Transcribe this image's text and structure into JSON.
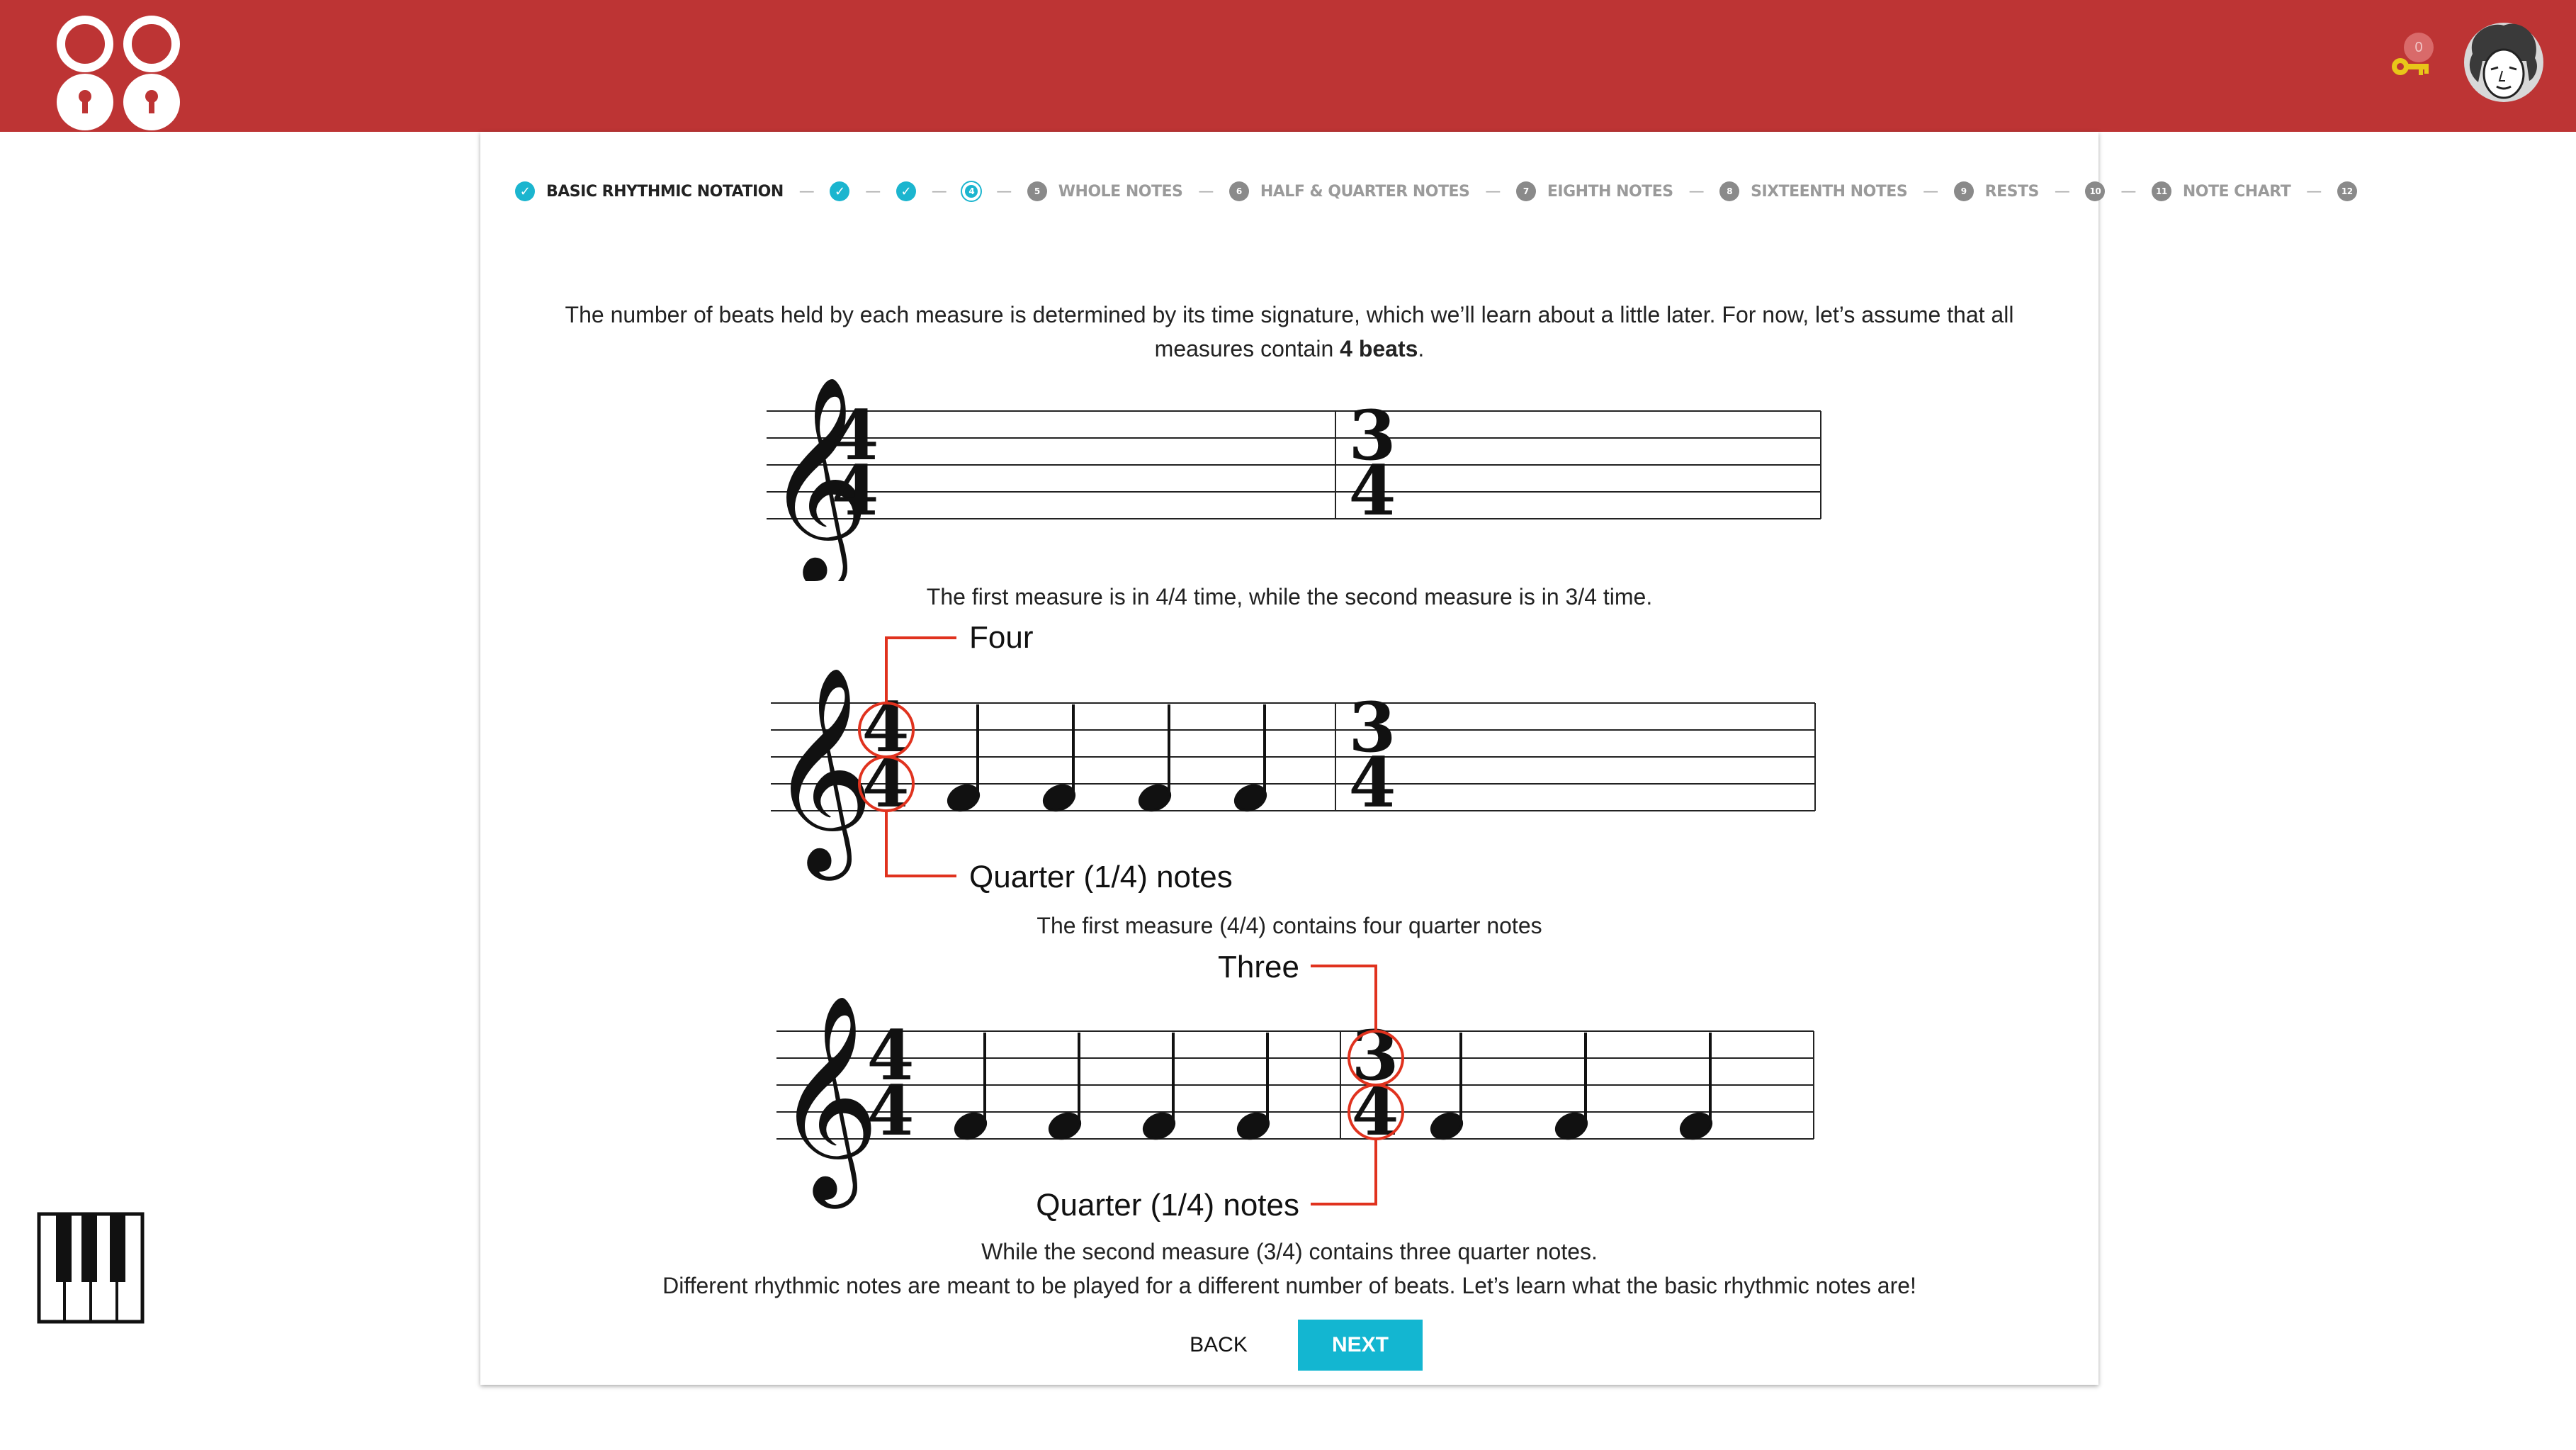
{
  "header": {
    "logo_icon": "eighty-eight-keys-logo-icon",
    "key_icon": "key-icon",
    "key_count": "0",
    "avatar_icon": "beethoven-avatar-icon",
    "bar_color": "#bd3434",
    "key_color": "#e8c619"
  },
  "sidebar": {
    "piano_icon": "piano-keys-icon"
  },
  "stepper": {
    "accent_color": "#1bb5cf",
    "steps": [
      {
        "number": "1",
        "label": "BASIC RHYTHMIC NOTATION",
        "status": "done"
      },
      {
        "number": "2",
        "label": "",
        "status": "done"
      },
      {
        "number": "3",
        "label": "",
        "status": "done"
      },
      {
        "number": "4",
        "label": "",
        "status": "current"
      },
      {
        "number": "5",
        "label": "WHOLE NOTES",
        "status": "todo"
      },
      {
        "number": "6",
        "label": "HALF & QUARTER NOTES",
        "status": "todo"
      },
      {
        "number": "7",
        "label": "EIGHTH NOTES",
        "status": "todo"
      },
      {
        "number": "8",
        "label": "SIXTEENTH NOTES",
        "status": "todo"
      },
      {
        "number": "9",
        "label": "RESTS",
        "status": "todo"
      },
      {
        "number": "10",
        "label": "",
        "status": "todo"
      },
      {
        "number": "11",
        "label": "NOTE CHART",
        "status": "todo"
      },
      {
        "number": "12",
        "label": "",
        "status": "todo"
      }
    ]
  },
  "content": {
    "intro_part1": "The number of beats held by each measure is determined by its time signature, which we’ll learn about a little later. For now, let’s assume that all measures contain ",
    "intro_bold": "4 beats",
    "intro_end": ".",
    "caption1": "The first measure is in 4/4 time, while the second measure is in 3/4 time.",
    "caption2": "The first measure (4/4) contains four quarter notes",
    "caption3": "While the second measure (3/4) contains three quarter notes.",
    "caption4": "Different rhythmic notes are meant to be played for a different number of beats. Let’s learn what the basic rhythmic notes are!"
  },
  "staff1": {
    "ts1_top": "4",
    "ts1_bottom": "4",
    "ts2_top": "3",
    "ts2_bottom": "4"
  },
  "staff2": {
    "ts1_top": "4",
    "ts1_bottom": "4",
    "ts2_top": "3",
    "ts2_bottom": "4",
    "label_top": "Four",
    "label_bottom": "Quarter (1/4) notes",
    "annotation_color": "#e0321e"
  },
  "staff3": {
    "ts1_top": "4",
    "ts1_bottom": "4",
    "ts2_top": "3",
    "ts2_bottom": "4",
    "label_top": "Three",
    "label_bottom": "Quarter (1/4) notes",
    "annotation_color": "#e0321e"
  },
  "buttons": {
    "back": "BACK",
    "next": "NEXT"
  }
}
